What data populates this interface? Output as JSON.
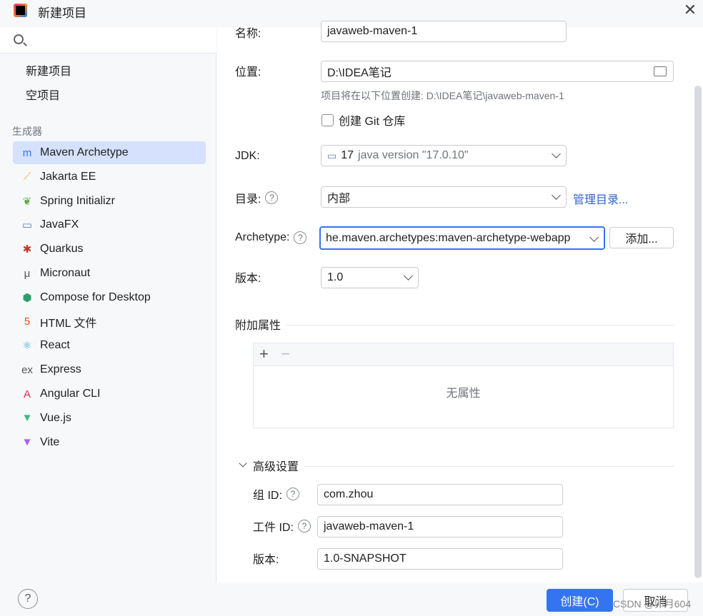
{
  "window": {
    "title": "新建项目"
  },
  "search": {
    "placeholder": ""
  },
  "sidebar": {
    "top_items": [
      {
        "label": "新建项目"
      },
      {
        "label": "空项目"
      }
    ],
    "generators_label": "生成器",
    "generators": [
      {
        "label": "Maven Archetype",
        "icon": "maven-icon",
        "glyph": "m",
        "color": "#3574f0"
      },
      {
        "label": "Jakarta EE",
        "icon": "jakarta-ee-icon",
        "glyph": "⟋",
        "color": "#f0a830"
      },
      {
        "label": "Spring Initializr",
        "icon": "spring-icon",
        "glyph": "❦",
        "color": "#5faa4a"
      },
      {
        "label": "JavaFX",
        "icon": "javafx-icon",
        "glyph": "▭",
        "color": "#5a7db5"
      },
      {
        "label": "Quarkus",
        "icon": "quarkus-icon",
        "glyph": "✱",
        "color": "#c0392b"
      },
      {
        "label": "Micronaut",
        "icon": "micronaut-icon",
        "glyph": "μ",
        "color": "#555"
      },
      {
        "label": "Compose for Desktop",
        "icon": "compose-icon",
        "glyph": "⬢",
        "color": "#2e9e6a"
      },
      {
        "label": "HTML 文件",
        "icon": "html5-icon",
        "glyph": "5",
        "color": "#e44d26"
      },
      {
        "label": "React",
        "icon": "react-icon",
        "glyph": "⚛",
        "color": "#38a9d8"
      },
      {
        "label": "Express",
        "icon": "express-icon",
        "glyph": "ex",
        "color": "#555"
      },
      {
        "label": "Angular CLI",
        "icon": "angular-icon",
        "glyph": "A",
        "color": "#d62f5a"
      },
      {
        "label": "Vue.js",
        "icon": "vue-icon",
        "glyph": "▼",
        "color": "#41b883"
      },
      {
        "label": "Vite",
        "icon": "vite-icon",
        "glyph": "▼",
        "color": "#a85cf0"
      }
    ]
  },
  "form": {
    "name_label": "名称:",
    "name_value": "javaweb-maven-1",
    "location_label": "位置:",
    "location_value": "D:\\IDEA笔记",
    "location_hint": "项目将在以下位置创建: D:\\IDEA笔记\\javaweb-maven-1",
    "git_label": "创建 Git 仓库",
    "jdk_label": "JDK:",
    "jdk_version": "17",
    "jdk_desc": "java version \"17.0.10\"",
    "catalog_label": "目录:",
    "catalog_value": "内部",
    "catalog_link": "管理目录...",
    "archetype_label": "Archetype:",
    "archetype_value": "he.maven.archetypes:maven-archetype-webapp",
    "add_button": "添加...",
    "version_label": "版本:",
    "version_value": "1.0",
    "props_label": "附加属性",
    "props_plus": "+",
    "props_minus": "−",
    "props_empty": "无属性",
    "advanced_label": "高级设置",
    "group_label": "组 ID:",
    "group_value": "com.zhou",
    "artifact_label": "工件 ID:",
    "artifact_value": "javaweb-maven-1",
    "adv_version_label": "版本:",
    "adv_version_value": "1.0-SNAPSHOT"
  },
  "footer": {
    "help": "?",
    "create_button": "创建(C)",
    "cancel_button": "取消",
    "watermark": "CSDN @卯月604"
  }
}
